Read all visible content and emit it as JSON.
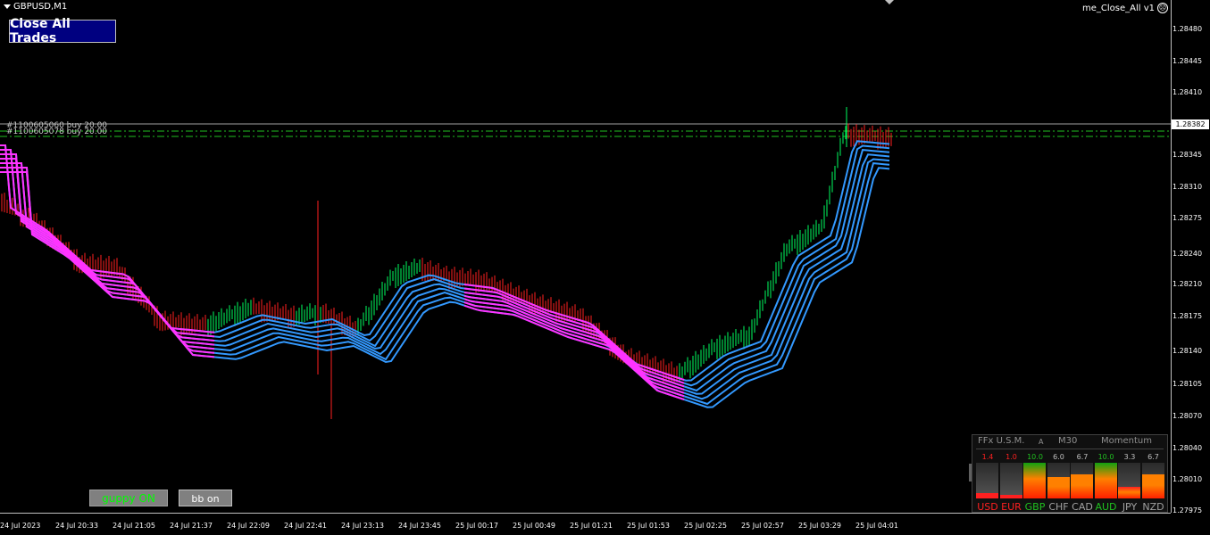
{
  "symbol": {
    "label": "GBPUSD,M1"
  },
  "expert": {
    "label": "me_Close_All v1",
    "face": "☹"
  },
  "close_all": {
    "label": "Close All Trades"
  },
  "orders": [
    {
      "label": "#1100605060 buy 20.00"
    },
    {
      "label": "#1100605078 buy 20.00"
    }
  ],
  "current_price": "1.28382",
  "y_ticks": [
    "1.28480",
    "1.28445",
    "1.28410",
    "1.28345",
    "1.28310",
    "1.28275",
    "1.28240",
    "1.28210",
    "1.28175",
    "1.28140",
    "1.28105",
    "1.28070",
    "1.28040",
    "1.28010",
    "1.27975"
  ],
  "x_ticks": [
    "24 Jul 2023",
    "24 Jul 20:33",
    "24 Jul 21:05",
    "24 Jul 21:37",
    "24 Jul 22:09",
    "24 Jul 22:41",
    "24 Jul 23:13",
    "24 Jul 23:45",
    "25 Jul 00:17",
    "25 Jul 00:49",
    "25 Jul 01:21",
    "25 Jul 01:53",
    "25 Jul 02:25",
    "25 Jul 02:57",
    "25 Jul 03:29",
    "25 Jul 04:01"
  ],
  "buttons": {
    "guppy": "guppy ON",
    "bb": "bb on"
  },
  "usm": {
    "title": "FFx U.S.M.",
    "mode": "A",
    "timeframe": "M30",
    "indicator": "Momentum",
    "currencies": [
      {
        "name": "USD",
        "value": "1.4",
        "strength": 0.14,
        "color": "#ff2020"
      },
      {
        "name": "EUR",
        "value": "1.0",
        "strength": 0.1,
        "color": "#ff2020"
      },
      {
        "name": "GBP",
        "value": "10.0",
        "strength": 1.0,
        "color": "#20c020"
      },
      {
        "name": "CHF",
        "value": "6.0",
        "strength": 0.6,
        "color": "#c0c0c0"
      },
      {
        "name": "CAD",
        "value": "6.7",
        "strength": 0.67,
        "color": "#c0c0c0"
      },
      {
        "name": "AUD",
        "value": "10.0",
        "strength": 1.0,
        "color": "#20c020"
      },
      {
        "name": "JPY",
        "value": "3.3",
        "strength": 0.33,
        "color": "#c0c0c0"
      },
      {
        "name": "NZD",
        "value": "6.7",
        "strength": 0.67,
        "color": "#c0c0c0"
      }
    ]
  },
  "colors": {
    "bull": "#00ff60",
    "bear": "#ff2020",
    "ema_up": "#3399ff",
    "ema_down": "#ff33ff",
    "order_line": "#20c020"
  }
}
